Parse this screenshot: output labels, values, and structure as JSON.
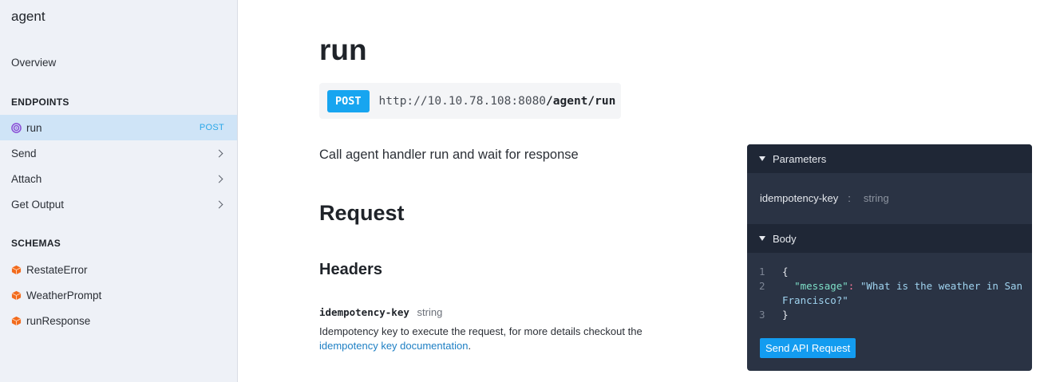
{
  "sidebar": {
    "title": "agent",
    "overview": "Overview",
    "endpoints_heading": "ENDPOINTS",
    "endpoints": [
      {
        "label": "run",
        "method": "POST",
        "icon": "target-icon",
        "active": true
      },
      {
        "label": "Send",
        "expandable": true
      },
      {
        "label": "Attach",
        "expandable": true
      },
      {
        "label": "Get Output",
        "expandable": true
      }
    ],
    "schemas_heading": "SCHEMAS",
    "schemas": [
      {
        "label": "RestateError",
        "icon": "cube-icon"
      },
      {
        "label": "WeatherPrompt",
        "icon": "cube-icon"
      },
      {
        "label": "runResponse",
        "icon": "cube-icon"
      }
    ]
  },
  "main": {
    "title": "run",
    "method": "POST",
    "url_base": "http://10.10.78.108:8080",
    "url_path": "/agent/run",
    "description": "Call agent handler run and wait for response",
    "request_heading": "Request",
    "headers_heading": "Headers",
    "param_name": "idempotency-key",
    "param_type": "string",
    "param_desc": "Idempotency key to execute the request, for more details checkout the",
    "param_link": "idempotency key documentation",
    "param_desc_end": "."
  },
  "panel": {
    "parameters_label": "Parameters",
    "param_key": "idempotency-key",
    "param_colon": ":",
    "param_placeholder": "string",
    "body_label": "Body",
    "code_lines": [
      {
        "n": "1",
        "text": "{"
      },
      {
        "n": "2",
        "key": "\"message\"",
        "sep": ": ",
        "val": "\"What is the weather in San"
      },
      {
        "n": "",
        "val": "Francisco?\""
      },
      {
        "n": "3",
        "text": "}"
      }
    ],
    "send_button": "Send API Request"
  },
  "colors": {
    "accent": "#17a5f0",
    "sidebar_bg": "#eef1f7",
    "active_bg": "#cfe4f7",
    "panel_bg": "#2a3344",
    "link": "#1d7fc4"
  }
}
